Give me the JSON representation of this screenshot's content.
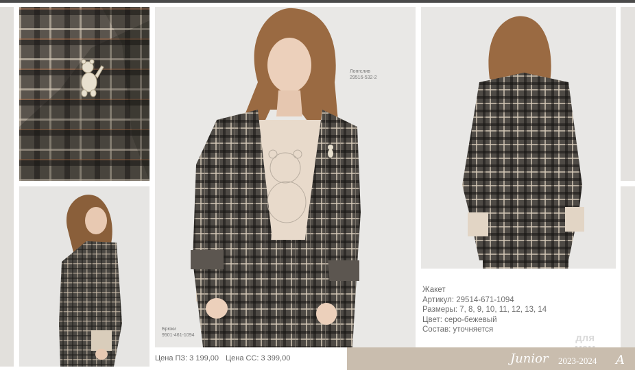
{
  "labels": {
    "longsleeve_name": "Лонгслив",
    "longsleeve_code": "29516-532-2",
    "trousers_name": "Брюки",
    "trousers_code": "9501-461-1094"
  },
  "prices": {
    "pz": "Цена ПЗ: 3 199,00",
    "ss": "Цена СС: 3 399,00"
  },
  "product": {
    "name": "Жакет",
    "article": "Артикул: 29514-671-1094",
    "sizes": "Размеры: 7, 8, 9, 10, 11, 12, 13, 14",
    "color": "Цвет: серо-бежевый",
    "composition": "Состав: уточняется"
  },
  "footer": {
    "collection": "Junior",
    "season": "2023-2024",
    "trailing_letter": "A"
  },
  "watermark": {
    "line1": "для",
    "line2": "мам"
  },
  "colors": {
    "background": "#ffffff",
    "footer_band": "#c9bdae",
    "text_gray": "#6e6e6e"
  }
}
